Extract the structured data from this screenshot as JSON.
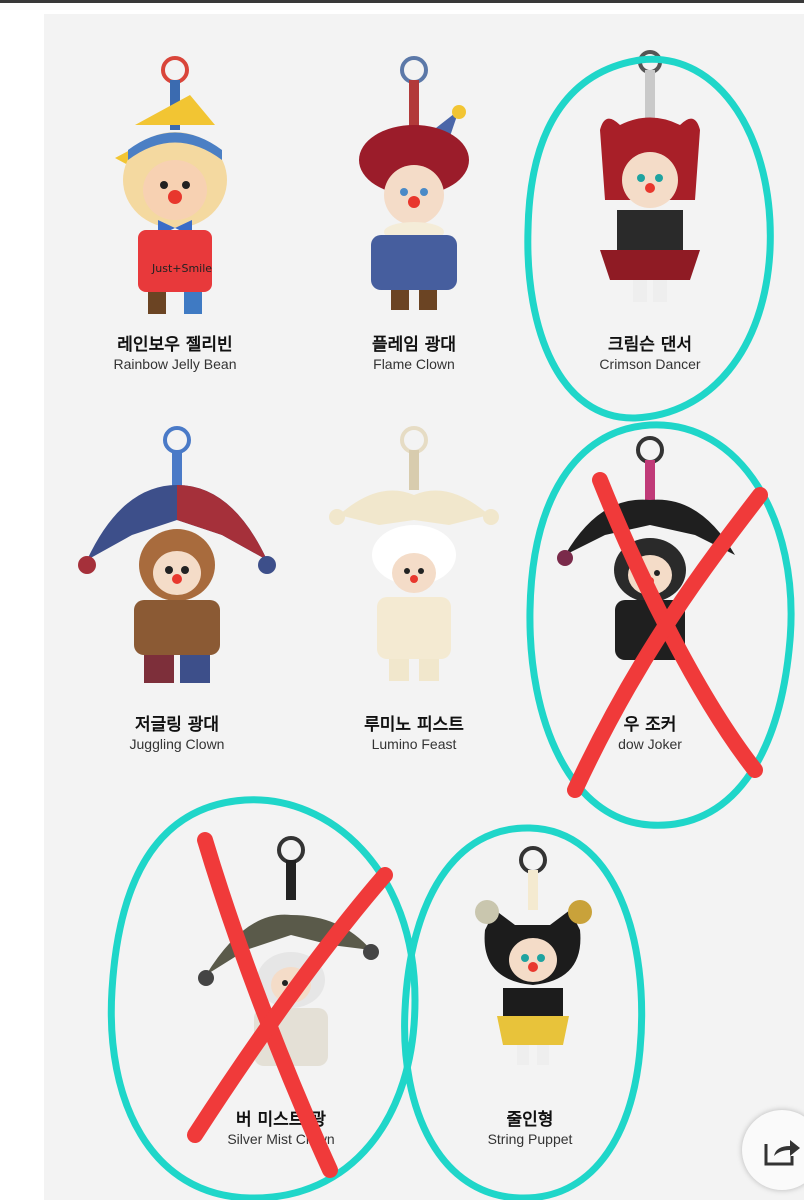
{
  "items": [
    {
      "ko": "레인보우 젤리빈",
      "en": "Rainbow Jelly Bean"
    },
    {
      "ko": "플레임 광대",
      "en": "Flame Clown"
    },
    {
      "ko": "크림슨 댄서",
      "en": "Crimson Dancer"
    },
    {
      "ko": "저글링 광대",
      "en": "Juggling Clown"
    },
    {
      "ko": "루미노 피스트",
      "en": "Lumino Feast"
    },
    {
      "ko": "우 조커",
      "en": "dow Joker"
    },
    {
      "ko": "버 미스트 광",
      "en": "Silver Mist Clown"
    },
    {
      "ko": "줄인형",
      "en": "String Puppet"
    }
  ],
  "colors": {
    "circle": "#1fd6c9",
    "cross": "#f03a3a",
    "panel": "#f3f3f3"
  },
  "icons": {
    "share": "share-icon"
  }
}
